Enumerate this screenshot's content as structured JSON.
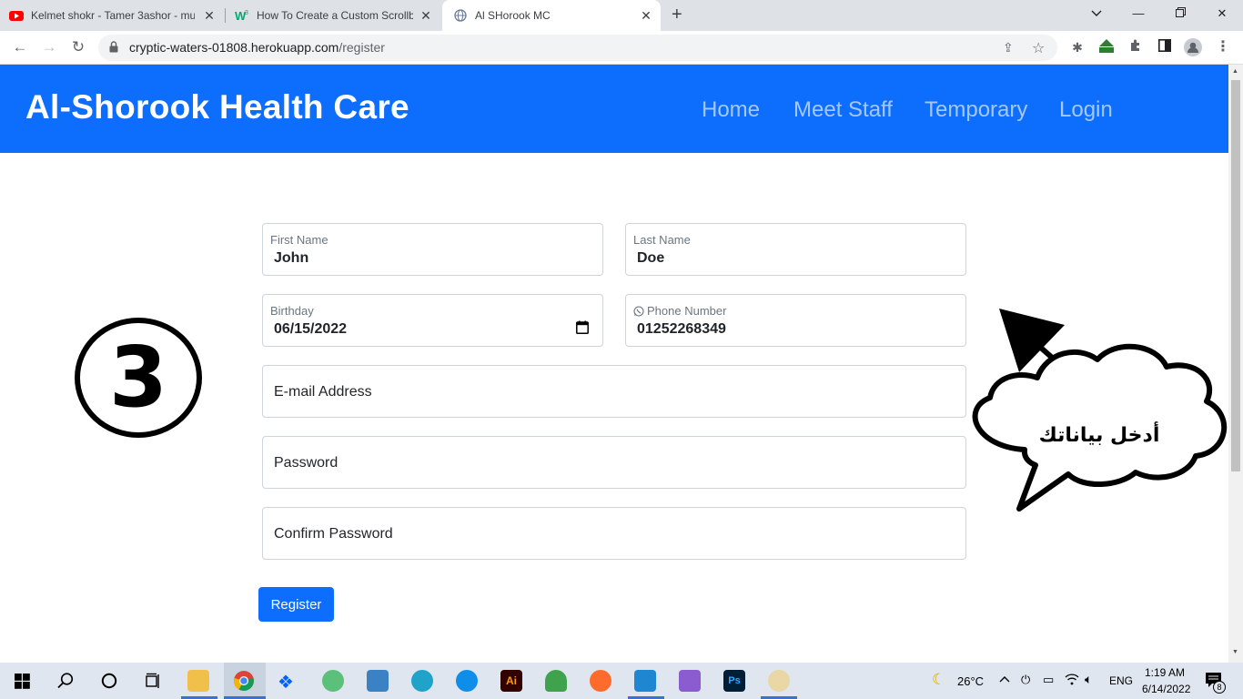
{
  "browser": {
    "tabs": [
      {
        "title": "Kelmet shokr - Tamer 3ashor - mu",
        "favicon": "youtube-icon"
      },
      {
        "title": "How To Create a Custom Scrollba",
        "favicon": "w3-icon"
      },
      {
        "title": "Al SHorook MC",
        "favicon": "globe-icon"
      }
    ],
    "url_host": "cryptic-waters-01808.herokuapp.com",
    "url_path": "/register"
  },
  "site": {
    "brand": "Al-Shorook Health Care",
    "nav": [
      "Home",
      "Meet Staff",
      "Temporary",
      "Login"
    ],
    "brand_color": "#0d6efd"
  },
  "form": {
    "first_name": {
      "label": "First Name",
      "value": "John"
    },
    "last_name": {
      "label": "Last Name",
      "value": "Doe"
    },
    "birthday": {
      "label": "Birthday",
      "value": "06/15/2022"
    },
    "phone": {
      "label": "Phone Number",
      "value": "01252268349"
    },
    "email": {
      "placeholder": "E-mail Address"
    },
    "password": {
      "placeholder": "Password"
    },
    "confirm_password": {
      "placeholder": "Confirm Password"
    },
    "submit_label": "Register"
  },
  "annotations": {
    "step_number": "3",
    "callout_text": "أدخل بياناتك"
  },
  "taskbar": {
    "weather": "26°C",
    "language": "ENG",
    "time": "1:19 AM",
    "date": "6/14/2022",
    "notifications": "8"
  }
}
